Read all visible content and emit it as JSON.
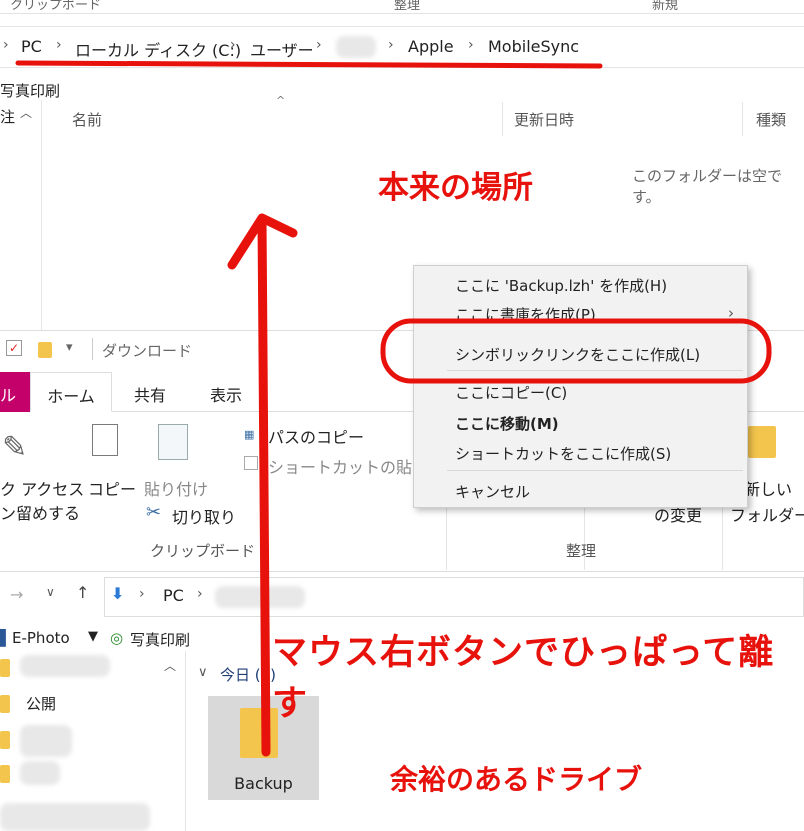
{
  "window_top": {
    "header_groups": [
      "クリップボード",
      "整理",
      "新規"
    ],
    "address_bar": {
      "crumbs": [
        "PC",
        "ローカル ディスク (C:)",
        "ユーザー",
        "Apple",
        "MobileSync"
      ]
    },
    "quick_access_label": "写真印刷",
    "nav_fragment": "注",
    "columns": [
      "名前",
      "更新日時",
      "種類"
    ],
    "empty_message": "このフォルダーは空です。"
  },
  "window_bottom": {
    "title": "ダウンロード",
    "tabs": [
      "ル",
      "ホーム",
      "共有",
      "表示"
    ],
    "ribbon": {
      "quick_access_line1": "ク アクセス",
      "quick_access_line2": "ン留めする",
      "copy": "コピー",
      "paste": "貼り付け",
      "copy_path": "パスのコピー",
      "paste_shortcut": "ショートカットの貼り付",
      "cut": "切り取り",
      "group_clipboard": "クリップボード",
      "group_organize": "整理",
      "rename_fragment": "の変更",
      "new_folder_line1": "新しい",
      "new_folder_line2": "フォルダー"
    },
    "address_crumbs": [
      "PC"
    ],
    "favorites": [
      "E-Photo",
      "写真印刷"
    ],
    "nav_items": [
      "公開"
    ],
    "group_header": "今日 (1)",
    "file": {
      "name": "Backup"
    }
  },
  "context_menu": {
    "items": [
      {
        "label": "ここに 'Backup.lzh' を作成(H)",
        "bold": false
      },
      {
        "label": "ここに書庫を作成(P)",
        "bold": false,
        "submenu": true
      },
      {
        "label": "シンボリックリンクをここに作成(L)",
        "bold": false
      },
      {
        "label": "ここにコピー(C)",
        "bold": false
      },
      {
        "label": "ここに移動(M)",
        "bold": true
      },
      {
        "label": "ショートカットをここに作成(S)",
        "bold": false
      },
      {
        "label": "キャンセル",
        "bold": false
      }
    ]
  },
  "annotations": {
    "original_location": "本来の場所",
    "drag_instruction": "マウス右ボタンでひっぱって離す",
    "spare_drive": "余裕のあるドライブ"
  },
  "colors": {
    "annotation_red": "#e8120c",
    "file_tab": "#c4006a",
    "folder": "#f3c54c"
  }
}
